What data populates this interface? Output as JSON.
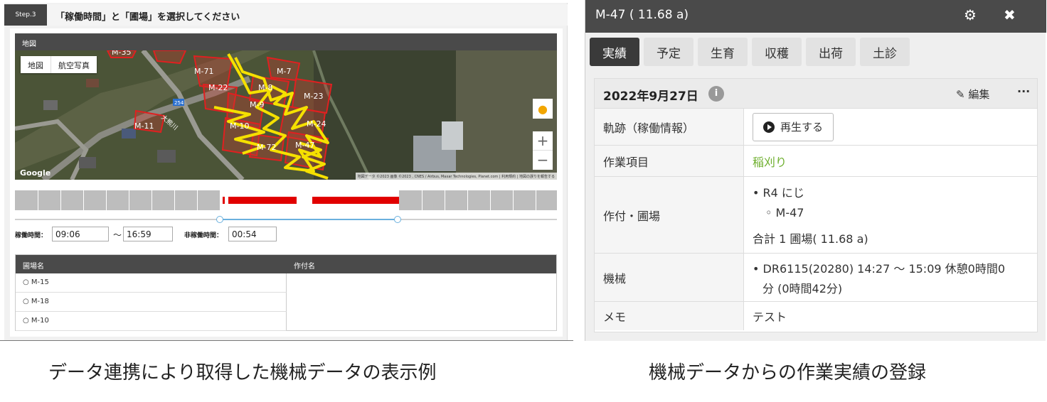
{
  "left_panel": {
    "step_label": "Step.3",
    "step_title": "「稼働時間」と「圃場」を選択してください",
    "map_header": "地図",
    "map_types": [
      "地図",
      "航空写真"
    ],
    "google_logo": "Google",
    "attribution": "地図データ ©2023 画像 ©2023 , CNES / Airbus, Maxar Technologies, Planet.com | 利用規約 | 地図の誤りを報告する",
    "field_labels": [
      "M-35",
      "M-71",
      "M-7",
      "M-22",
      "M-8",
      "M-23",
      "M-9",
      "M-10",
      "M-24",
      "M-11",
      "M-72",
      "M-47",
      "254",
      "大熊川"
    ],
    "operating_time_label": "稼働時間：",
    "start_time": "09:06",
    "tilde": "〜",
    "end_time": "16:59",
    "idle_time_label": "非稼働時間：",
    "idle_time": "00:54",
    "table": {
      "headers": [
        "圃場名",
        "作付名"
      ],
      "rows": [
        "M-15",
        "M-18",
        "M-10"
      ]
    }
  },
  "right_panel": {
    "title": "M-47 ( 11.68 a)",
    "tabs": [
      "実績",
      "予定",
      "生育",
      "収穫",
      "出荷",
      "土診"
    ],
    "date": "2022年9月27日",
    "info_icon": "i",
    "edit_label": "編集",
    "more_label": "···",
    "rows": {
      "track_label": "軌跡（稼働情報）",
      "play_label": "再生する",
      "work_label": "作業項目",
      "work_value": "稲刈り",
      "crop_label": "作付・圃場",
      "crop_name": "R4 にじ",
      "field_name": "M-47",
      "total": "合計 1 圃場( 11.68 a)",
      "machine_label": "機械",
      "machine_value_1": "DR6115(20280) 14:27 〜 15:09 休憩0時間0",
      "machine_value_2": "分 (0時間42分)",
      "memo_label": "メモ",
      "memo_value": "テスト"
    }
  },
  "captions": {
    "left": "データ連携により取得した機械データの表示例",
    "right": "機械データからの作業実績の登録"
  },
  "colors": {
    "track_yellow": "#f5e000",
    "field_red": "#e02020",
    "timeline_red": "#e10000",
    "accent_green": "#6cae2b"
  }
}
